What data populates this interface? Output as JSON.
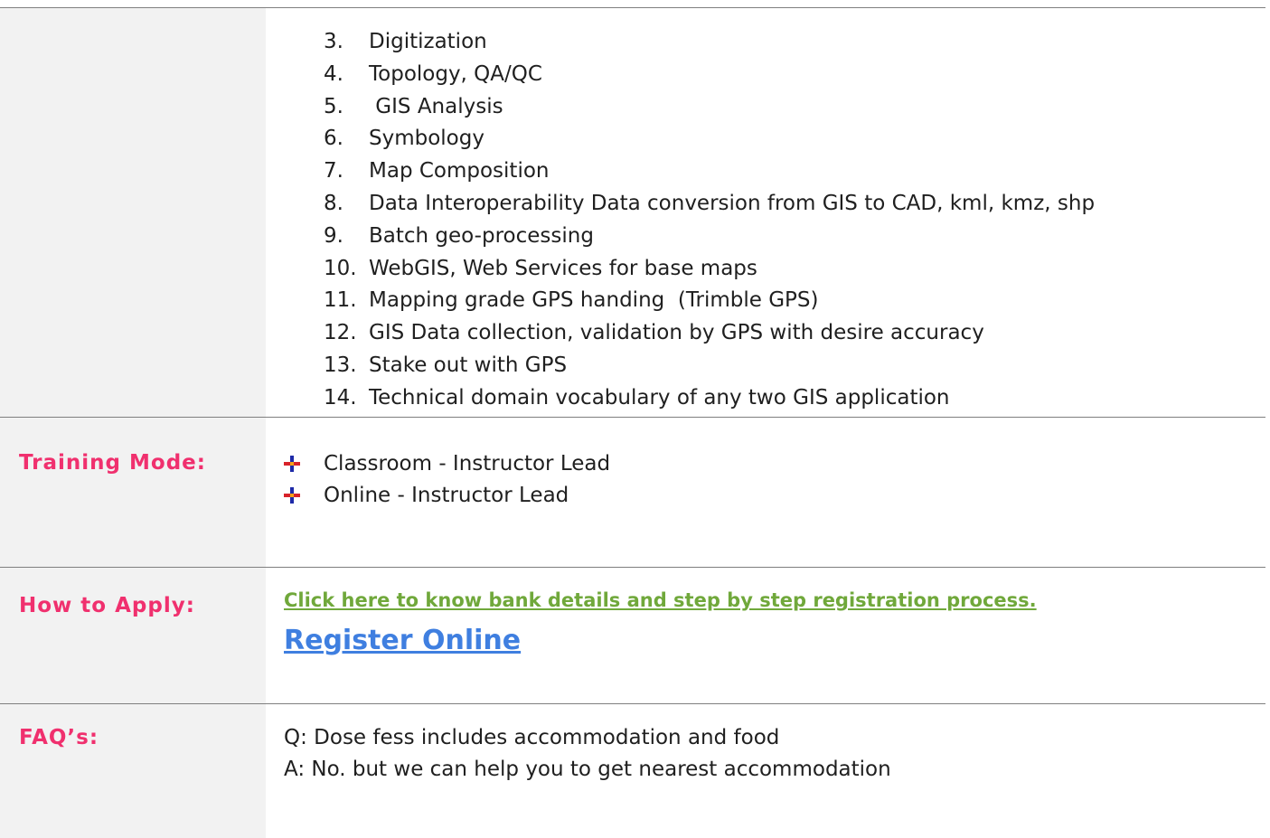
{
  "syllabus": {
    "items": [
      {
        "number": "3.",
        "text": "Digitization"
      },
      {
        "number": "4.",
        "text": "Topology, QA/QC"
      },
      {
        "number": "5.",
        "text": " GIS Analysis"
      },
      {
        "number": "6.",
        "text": "Symbology"
      },
      {
        "number": "7.",
        "text": "Map Composition"
      },
      {
        "number": "8.",
        "text": "Data Interoperability Data conversion from GIS to CAD, kml, kmz, shp"
      },
      {
        "number": "9.",
        "text": "Batch geo-processing"
      },
      {
        "number": "10.",
        "text": "WebGIS, Web Services for base maps"
      },
      {
        "number": "11.",
        "text": "Mapping grade GPS handing  (Trimble GPS)"
      },
      {
        "number": "12.",
        "text": "GIS Data collection, validation by GPS with desire accuracy"
      },
      {
        "number": "13.",
        "text": "Stake out with GPS"
      },
      {
        "number": "14.",
        "text": "Technical domain vocabulary of any two GIS application"
      }
    ]
  },
  "training_mode": {
    "label": "Training Mode:",
    "items": [
      "Classroom - Instructor Lead",
      "Online - Instructor Lead"
    ],
    "bullet_icon": "pin-bullet-icon"
  },
  "how_to_apply": {
    "label": "How to Apply:",
    "bank_link": "Click here to know bank details and step by step registration process.",
    "register_link": "Register Online"
  },
  "faq": {
    "label": "FAQ’s:",
    "question": "Q: Dose fess includes accommodation and food",
    "answer": "A: No. but we can help you to get nearest accommodation"
  },
  "colors": {
    "label_text": "#f0306e",
    "label_bg": "#f2f2f2",
    "link_green": "#70a83b",
    "link_blue": "#3f7fe0",
    "rule": "#7f7f7f"
  }
}
